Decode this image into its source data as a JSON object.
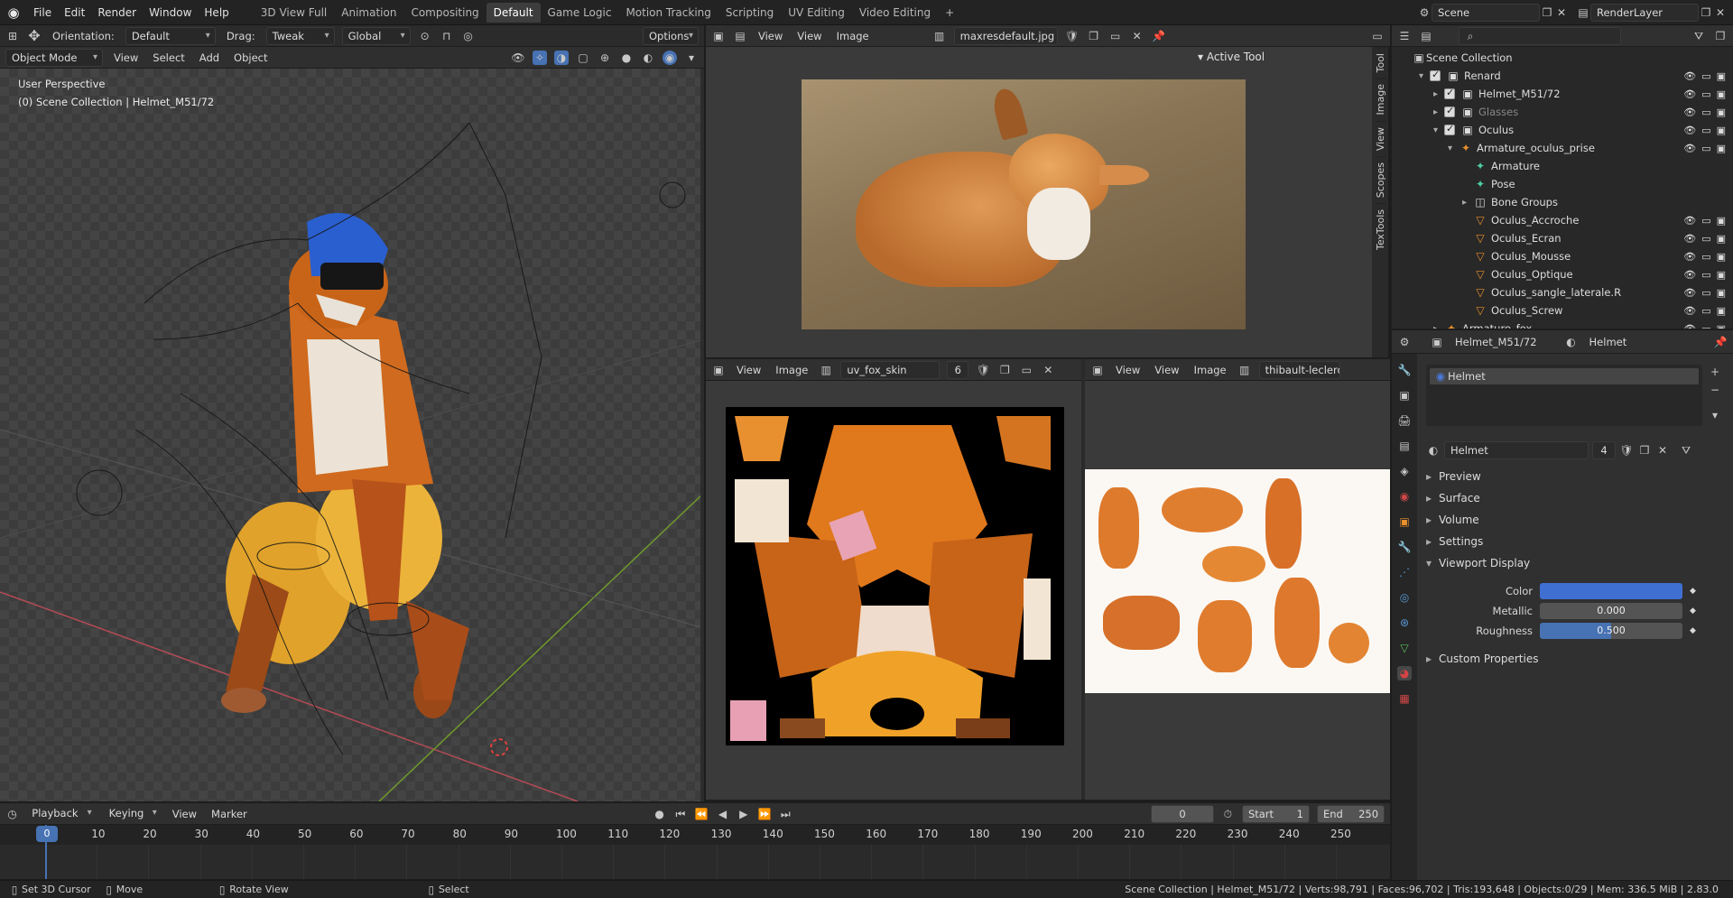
{
  "topbar": {
    "menus": [
      "File",
      "Edit",
      "Render",
      "Window",
      "Help"
    ],
    "tabs": [
      "3D View Full",
      "Animation",
      "Compositing",
      "Default",
      "Game Logic",
      "Motion Tracking",
      "Scripting",
      "UV Editing",
      "Video Editing"
    ],
    "active_tab": "Default",
    "scene": "Scene",
    "render_layer": "RenderLayer"
  },
  "toolbar3d": {
    "orientation_label": "Orientation:",
    "orientation_value": "Default",
    "drag_label": "Drag:",
    "drag_value": "Tweak",
    "transform": "Global",
    "options": "Options"
  },
  "viewport": {
    "mode": "Object Mode",
    "menus": [
      "View",
      "Select",
      "Add",
      "Object"
    ],
    "perspective": "User Perspective",
    "collection_info": "(0) Scene Collection | Helmet_M51/72"
  },
  "image_editor_top": {
    "menus": [
      "View",
      "View",
      "Image"
    ],
    "image_name": "maxresdefault.jpg",
    "active_tool": "Active Tool",
    "side_tabs": [
      "Tool",
      "Image",
      "View",
      "Scopes",
      "TexTools"
    ]
  },
  "uv_editor": {
    "menus": [
      "View",
      "Image"
    ],
    "image_name": "uv_fox_skin",
    "users": "6"
  },
  "ref_editor": {
    "menus": [
      "View",
      "View",
      "Image"
    ],
    "image_name": "thibault-leclercq"
  },
  "outliner": {
    "search_placeholder": "",
    "root": "Scene Collection",
    "rows": [
      {
        "label": "Renard",
        "indent": 1,
        "type": "collection"
      },
      {
        "label": "Helmet_M51/72",
        "indent": 2,
        "type": "collection"
      },
      {
        "label": "Glasses",
        "indent": 2,
        "type": "collection"
      },
      {
        "label": "Oculus",
        "indent": 2,
        "type": "collection"
      },
      {
        "label": "Armature_oculus_prise",
        "indent": 3,
        "type": "armature"
      },
      {
        "label": "Armature",
        "indent": 4,
        "type": "data"
      },
      {
        "label": "Pose",
        "indent": 4,
        "type": "pose"
      },
      {
        "label": "Bone Groups",
        "indent": 4,
        "type": "group"
      },
      {
        "label": "Oculus_Accroche",
        "indent": 4,
        "type": "mesh"
      },
      {
        "label": "Oculus_Ecran",
        "indent": 4,
        "type": "mesh"
      },
      {
        "label": "Oculus_Mousse",
        "indent": 4,
        "type": "mesh"
      },
      {
        "label": "Oculus_Optique",
        "indent": 4,
        "type": "mesh"
      },
      {
        "label": "Oculus_sangle_laterale.R",
        "indent": 4,
        "type": "mesh"
      },
      {
        "label": "Oculus_Screw",
        "indent": 4,
        "type": "mesh"
      },
      {
        "label": "Armature_fox",
        "indent": 2,
        "type": "armature"
      }
    ]
  },
  "properties": {
    "object_name": "Helmet_M51/72",
    "material_name": "Helmet",
    "slot": "Helmet",
    "material_field": "Helmet",
    "material_users": "4",
    "sections": [
      "Preview",
      "Surface",
      "Volume",
      "Settings",
      "Viewport Display"
    ],
    "color_label": "Color",
    "metallic_label": "Metallic",
    "metallic_value": "0.000",
    "roughness_label": "Roughness",
    "roughness_value": "0.500",
    "custom": "Custom Properties"
  },
  "timeline": {
    "menus": [
      "Playback",
      "Keying",
      "View",
      "Marker"
    ],
    "current_frame": "0",
    "start_label": "Start",
    "start": "1",
    "end_label": "End",
    "end": "250",
    "ticks": [
      "0",
      "10",
      "20",
      "30",
      "40",
      "50",
      "60",
      "70",
      "80",
      "90",
      "100",
      "110",
      "120",
      "130",
      "140",
      "150",
      "160",
      "170",
      "180",
      "190",
      "200",
      "210",
      "220",
      "230",
      "240",
      "250"
    ]
  },
  "statusbar": {
    "items": [
      "Set 3D Cursor",
      "Move",
      "Rotate View",
      "Select"
    ],
    "stats": "Scene Collection | Helmet_M51/72 | Verts:98,791 | Faces:96,702 | Tris:193,648 | Objects:0/29 | Mem: 336.5 MiB | 2.83.0"
  },
  "colors": {
    "accent": "#4772b3",
    "slider_fill": "#4772b3",
    "material_color": "#3f6fd1"
  }
}
